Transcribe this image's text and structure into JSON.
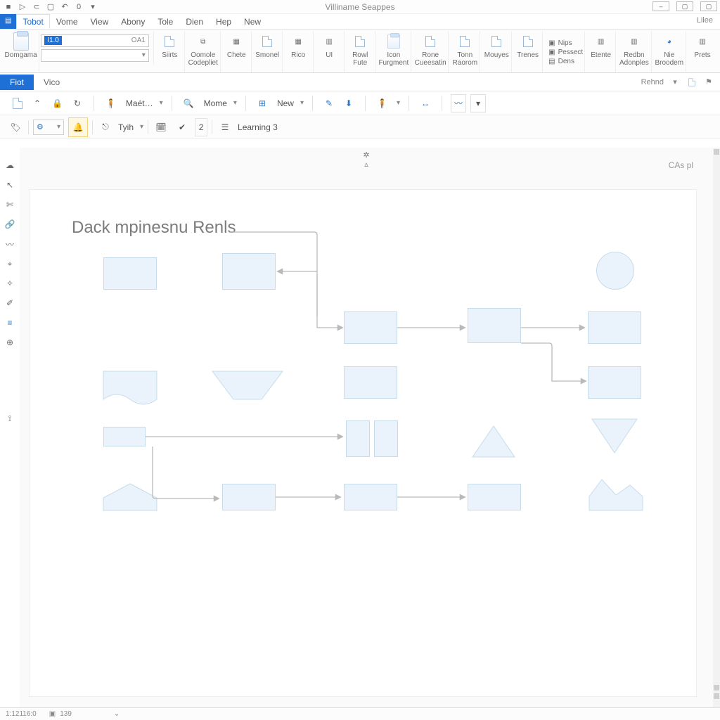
{
  "window": {
    "title": "Villiname Seappes",
    "menu_corner": "Lilee"
  },
  "ribbon": {
    "tabs": [
      "Tobot",
      "Vome",
      "View",
      "Abony",
      "Tole",
      "Dien",
      "Hep",
      "New"
    ],
    "active_tab": 0,
    "name_box_selected": "I1.0",
    "name_box_right": "OA1",
    "groups": [
      {
        "label": "Domgama",
        "icon": "clipboard-icon"
      },
      {
        "label": "Siirts",
        "icon": "doc-icon"
      },
      {
        "label": "Oomole\nCodepliet",
        "icon": "copy-icon"
      },
      {
        "label": "Chete",
        "icon": "chart-icon"
      },
      {
        "label": "Smonel",
        "icon": "doc-icon"
      },
      {
        "label": "Rico",
        "icon": "grid-icon"
      },
      {
        "label": "UI",
        "icon": "panel-icon"
      },
      {
        "label": "Rowl\nFute",
        "icon": "doc-icon"
      },
      {
        "label": "Icon\nFurgment",
        "icon": "clipboard-icon"
      },
      {
        "label": "Rone\nCueesatin",
        "icon": "doc-icon"
      },
      {
        "label": "Tonn\nRaorom",
        "icon": "doc-icon"
      },
      {
        "label": "Mouyes",
        "icon": "doc-icon"
      },
      {
        "label": "Trenes",
        "icon": "doc-icon"
      },
      {
        "label": "Etente",
        "icon": "panel-icon"
      },
      {
        "label": "Redbn\nAdonples",
        "icon": "panel-icon"
      },
      {
        "label": "Nie\nBroodem",
        "icon": "chart-icon"
      },
      {
        "label": "Prets",
        "icon": "panel-icon"
      }
    ],
    "pair_items": [
      "Nips",
      "Pessect",
      "Dens"
    ]
  },
  "subbar": {
    "tabs": [
      "Fiot",
      "Vico"
    ],
    "active_tab": 0,
    "right_label": "Rehnd"
  },
  "toolbar1": {
    "mat_label": "Maét…",
    "search_label": "Mome",
    "new_label": "New"
  },
  "toolbar2": {
    "combo_value": "",
    "dropdown_label": "Tyih",
    "counter_value": "2",
    "menu_label": "Learning 3"
  },
  "canvas": {
    "title": "Dаck mpinesnu Renls",
    "corner_tag": "CAs pl",
    "gizmo": "✲"
  },
  "status": {
    "left": "1:12116:0",
    "right": "139"
  },
  "colors": {
    "accent": "#1e6fd6",
    "shape_fill": "#eaf3fb",
    "shape_stroke": "#c7dceb",
    "connector": "#b9b9b9"
  }
}
